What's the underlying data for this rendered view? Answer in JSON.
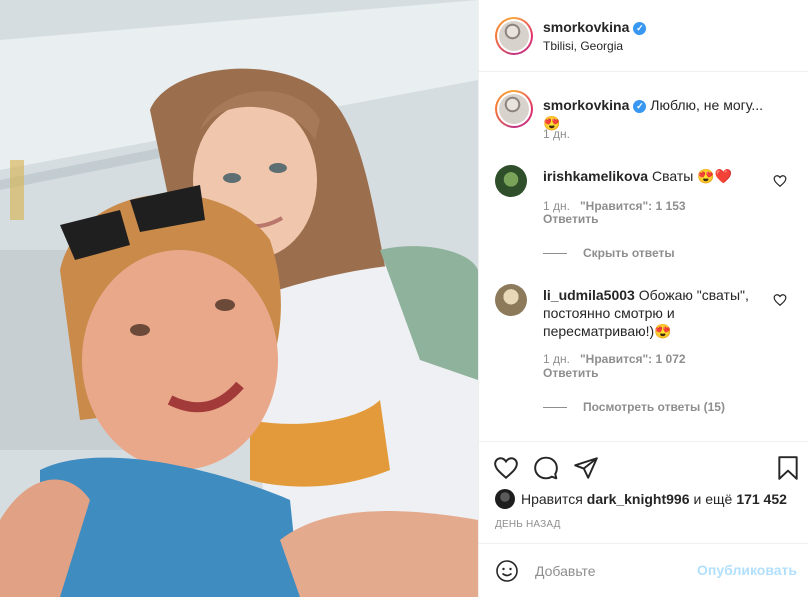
{
  "post": {
    "username": "smorkovkina",
    "location": "Tbilisi, Georgia",
    "more_label": "•••"
  },
  "caption": {
    "username": "smorkovkina",
    "text": "Люблю, не могу... 😍",
    "time": "1 дн."
  },
  "comments": [
    {
      "username": "irishkamelikova",
      "text": "Сваты 😍❤️",
      "time": "1 дн.",
      "likes": "\"Нравится\": 1 153",
      "reply_label": "Ответить",
      "replies_toggle": "Скрыть ответы"
    },
    {
      "username": "li_udmila5003",
      "text": "Обожаю \"сваты\", постоянно смотрю и пересматриваю!)😍",
      "time": "1 дн.",
      "likes": "\"Нравится\": 1 072",
      "reply_label": "Ответить",
      "replies_toggle": "Посмотреть ответы (15)"
    }
  ],
  "likes_summary": {
    "prefix": "Нравится",
    "user": "dark_knight996",
    "middle": "и ещё",
    "count": "171 452"
  },
  "date": "ДЕНЬ НАЗАД",
  "add_comment": {
    "placeholder": "Добавьте",
    "publish_label": "Опубликовать"
  },
  "colors": {
    "verified": "#3897f0",
    "heart_red": "#ed4956",
    "publish_disabled": "#b2dffc",
    "secondary_text": "#8e8e8e"
  },
  "icons": [
    "heart-icon",
    "comment-icon",
    "share-icon",
    "bookmark-icon",
    "emoji-icon",
    "verified-icon"
  ]
}
